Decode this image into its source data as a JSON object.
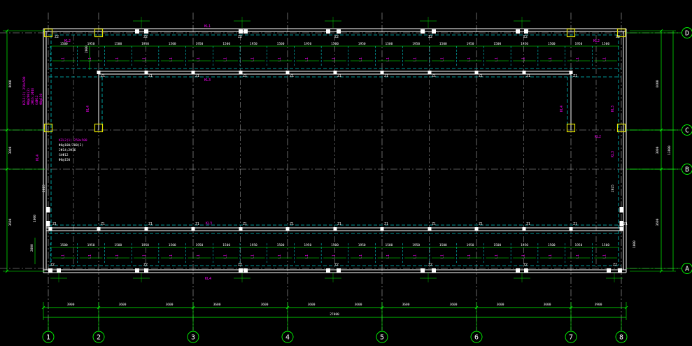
{
  "columns": [
    "1",
    "2",
    "3",
    "4",
    "5",
    "6",
    "7",
    "8"
  ],
  "rows": [
    "D",
    "C",
    "B",
    "A"
  ],
  "bottom_spans": [
    "3900",
    "3600",
    "3600",
    "3600",
    "3600",
    "3600",
    "3600",
    "3900"
  ],
  "bottom_total": "27000",
  "bay_dims": [
    "1500",
    "1950",
    "1500",
    "1950",
    "1500",
    "1950",
    "1500",
    "1950",
    "1500",
    "1950",
    "1500",
    "1950",
    "1500",
    "1950",
    "1500",
    "1950",
    "1500",
    "1950",
    "1500",
    "1950",
    "1500"
  ],
  "vertical_dims_left": [
    "8600",
    "3000",
    "3600"
  ],
  "vertical_dims_right": [
    "6600",
    "3000",
    "3600",
    "13800"
  ],
  "dim_labels": {
    "side_top": "2000",
    "side_bottom": "2000",
    "small_left": "2025",
    "small_right": "2025",
    "edge_left": "1000",
    "edge_right": "1000"
  },
  "element_labels": {
    "col_z": "Z1",
    "col_z2": "Z2",
    "beam_top": "KL1",
    "beam_top2": "KL2",
    "beam_side": "KL3",
    "beam_side2": "KL4",
    "bay_beam": "L1"
  },
  "left_note": [
    "KZL1(1) 250x500",
    "Φ8@200(2)",
    "2Φ16;2Φ16",
    "G4Φ12",
    "Φ8@150"
  ],
  "mid_note": [
    "KZL2(1) 250x500",
    "Φ8@100/200(2)",
    "2Φ14;2Φ16",
    "G4Φ12",
    "Φ8@150"
  ],
  "colors": {
    "grid": "#00ff00",
    "axis": "#b0b0b0",
    "wall": "#ffffff",
    "dash": "#00c8c8",
    "label": "#ff00ff",
    "column": "#e0e000",
    "text": "#ffffff"
  }
}
